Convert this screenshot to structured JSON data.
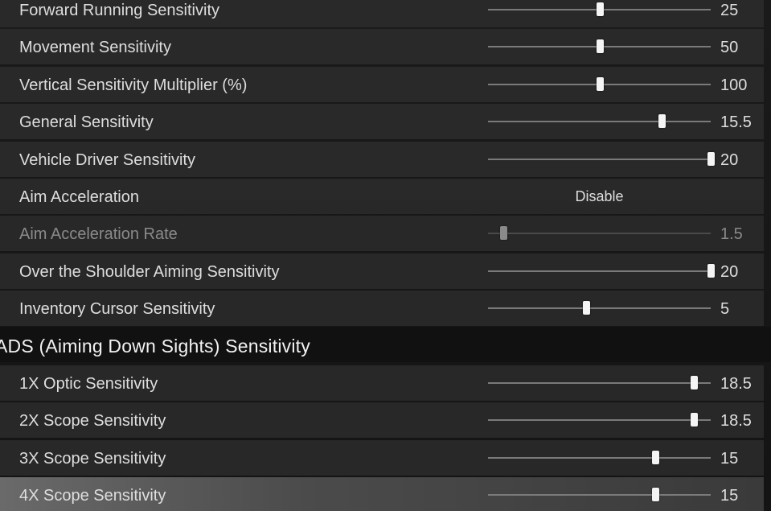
{
  "general_rows": [
    {
      "label": "Forward Running Sensitivity",
      "value": "25",
      "fill": 0.5
    },
    {
      "label": "Movement Sensitivity",
      "value": "50",
      "fill": 0.5
    },
    {
      "label": "Vertical Sensitivity Multiplier (%)",
      "value": "100",
      "fill": 0.5
    },
    {
      "label": "General Sensitivity",
      "value": "15.5",
      "fill": 0.78
    },
    {
      "label": "Vehicle Driver Sensitivity",
      "value": "20",
      "fill": 1.0
    },
    {
      "label": "Aim Acceleration",
      "value": "Disable",
      "type": "choice"
    },
    {
      "label": "Aim Acceleration Rate",
      "value": "1.5",
      "fill": 0.07,
      "disabled": true
    },
    {
      "label": "Over the Shoulder Aiming Sensitivity",
      "value": "20",
      "fill": 1.0
    },
    {
      "label": "Inventory Cursor Sensitivity",
      "value": "5",
      "fill": 0.44
    }
  ],
  "ads_section": {
    "title": "ADS (Aiming Down Sights) Sensitivity"
  },
  "ads_rows": [
    {
      "label": "1X Optic Sensitivity",
      "value": "18.5",
      "fill": 0.925
    },
    {
      "label": "2X Scope Sensitivity",
      "value": "18.5",
      "fill": 0.925
    },
    {
      "label": "3X Scope Sensitivity",
      "value": "15",
      "fill": 0.75
    },
    {
      "label": "4X Scope Sensitivity",
      "value": "15",
      "fill": 0.75,
      "hovered": true
    }
  ]
}
